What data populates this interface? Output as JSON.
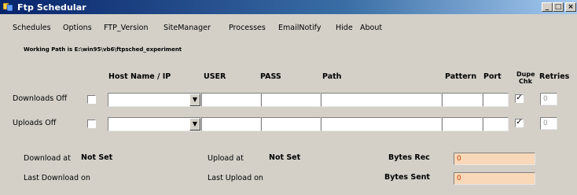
{
  "window": {
    "title": "Ftp Schedular"
  },
  "menu": [
    "Schedules",
    "Options",
    "FTP_Version",
    "SiteManager",
    "Processes",
    "EmailNotify",
    "Hide",
    "About"
  ],
  "working_path": "Working Path is E:\\win95\\vb6\\ftpsched_experiment",
  "columns": {
    "host": "Host Name / IP",
    "user": "USER",
    "pass": "PASS",
    "path": "Path",
    "pattern": "Pattern",
    "port": "Port",
    "dupe_line1": "Dupe",
    "dupe_line2": "Chk",
    "retries": "Retries"
  },
  "rows": {
    "downloads": {
      "label": "Downloads Off",
      "enabled_checked": false,
      "dupe_checked": true,
      "retries": "0"
    },
    "uploads": {
      "label": "Uploads Off",
      "enabled_checked": false,
      "dupe_checked": true,
      "retries": "0"
    }
  },
  "status": {
    "download_at_label": "Download at",
    "download_at_value": "Not Set",
    "upload_at_label": "Upload at",
    "upload_at_value": "Not Set",
    "last_download_label": "Last Download on",
    "last_upload_label": "Last Upload on",
    "bytes_rec_label": "Bytes Rec",
    "bytes_rec_value": "0",
    "bytes_sent_label": "Bytes Sent",
    "bytes_sent_value": "0"
  },
  "icons": {
    "app": "ftp-app-icon",
    "minimize": "minimize-icon",
    "maximize": "maximize-icon",
    "close": "close-icon",
    "dropdown": "chevron-down-icon",
    "check": "check-icon"
  },
  "colors": {
    "titlebar_start": "#08246b",
    "titlebar_end": "#a6caf0",
    "window_bg": "#d4d0c8",
    "bytes_field_bg": "#f8d8b8",
    "bytes_value_color": "#c04000"
  }
}
